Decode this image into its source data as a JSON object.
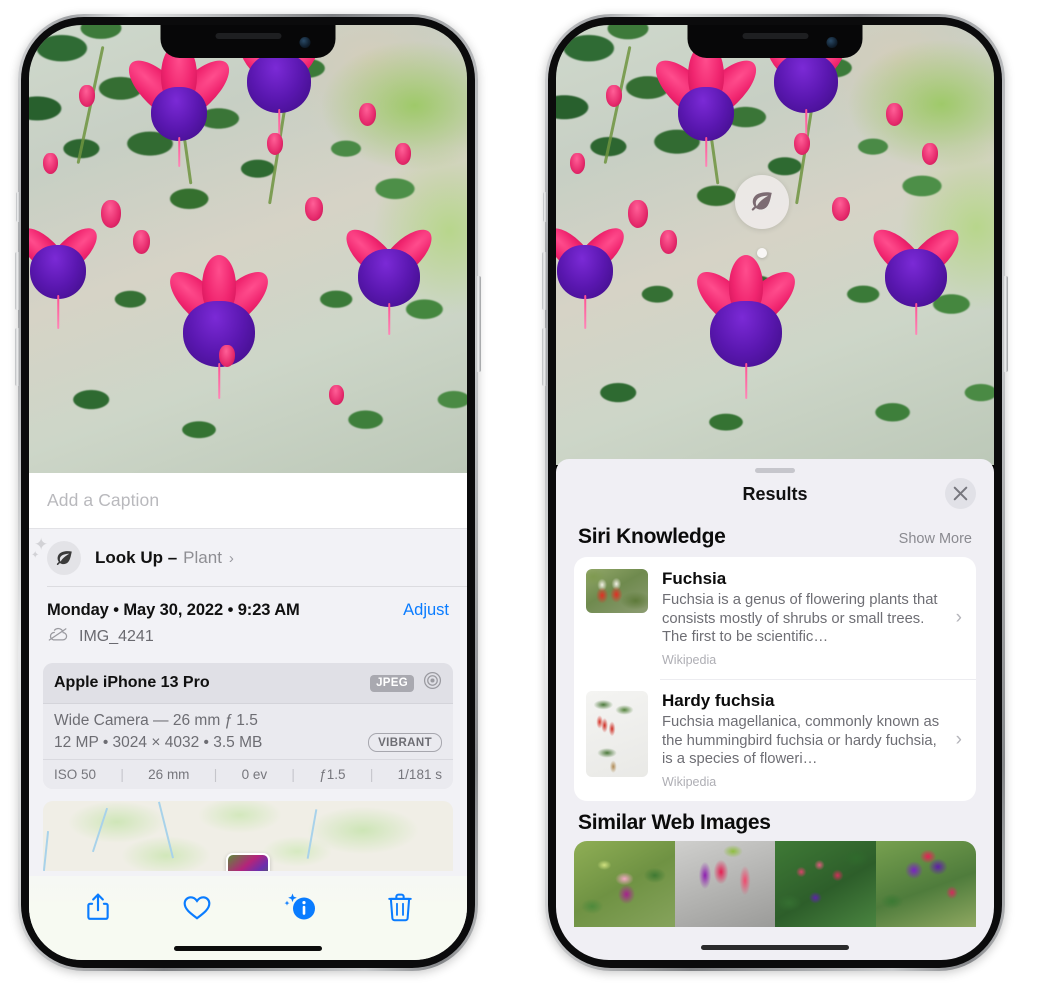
{
  "left_phone": {
    "caption": {
      "placeholder": "Add a Caption",
      "value": ""
    },
    "lookup": {
      "label": "Look Up –",
      "value": "Plant",
      "chevron": "›",
      "icon": "leaf-icon"
    },
    "meta": {
      "date": "Monday • May 30, 2022 • 9:23 AM",
      "adjust": "Adjust",
      "filename": "IMG_4241",
      "cloud_icon": "icloud-slash-icon"
    },
    "exif": {
      "device": "Apple iPhone 13 Pro",
      "format_badge": "JPEG",
      "lens_icon": "aperture-icon",
      "lens": "Wide Camera — 26 mm ƒ 1.5",
      "specs": "12 MP • 3024 × 4032 • 3.5 MB",
      "style_badge": "VIBRANT",
      "settings": [
        "ISO 50",
        "26 mm",
        "0 ev",
        "ƒ1.5",
        "1/181 s"
      ]
    },
    "toolbar": [
      {
        "name": "share-button",
        "icon": "share-icon"
      },
      {
        "name": "favorite-button",
        "icon": "heart-icon"
      },
      {
        "name": "info-button",
        "icon": "info-sparkle-icon"
      },
      {
        "name": "delete-button",
        "icon": "trash-icon"
      }
    ]
  },
  "right_phone": {
    "badge": {
      "icon": "leaf-icon"
    },
    "sheet": {
      "title": "Results",
      "close_label": "✕"
    },
    "siri_knowledge": {
      "title": "Siri Knowledge",
      "action": "Show More",
      "cards": [
        {
          "title": "Fuchsia",
          "description": "Fuchsia is a genus of flowering plants that consists mostly of shrubs or small trees. The first to be scientific…",
          "source": "Wikipedia",
          "chevron": "›"
        },
        {
          "title": "Hardy fuchsia",
          "description": "Fuchsia magellanica, commonly known as the hummingbird fuchsia or hardy fuchsia, is a species of floweri…",
          "source": "Wikipedia",
          "chevron": "›"
        }
      ]
    },
    "similar_web_images": {
      "title": "Similar Web Images",
      "thumbnails": [
        "fuchsia-pink-white",
        "fuchsia-red-magenta",
        "fuchsia-bush",
        "fuchsia-purple-red"
      ]
    }
  },
  "colors": {
    "accent_blue": "#0a7cff",
    "sheet_bg": "#f2f2f6",
    "results_bg": "#f0eff4",
    "card_bg": "#ffffff",
    "secondary_text": "#8e8e93"
  }
}
